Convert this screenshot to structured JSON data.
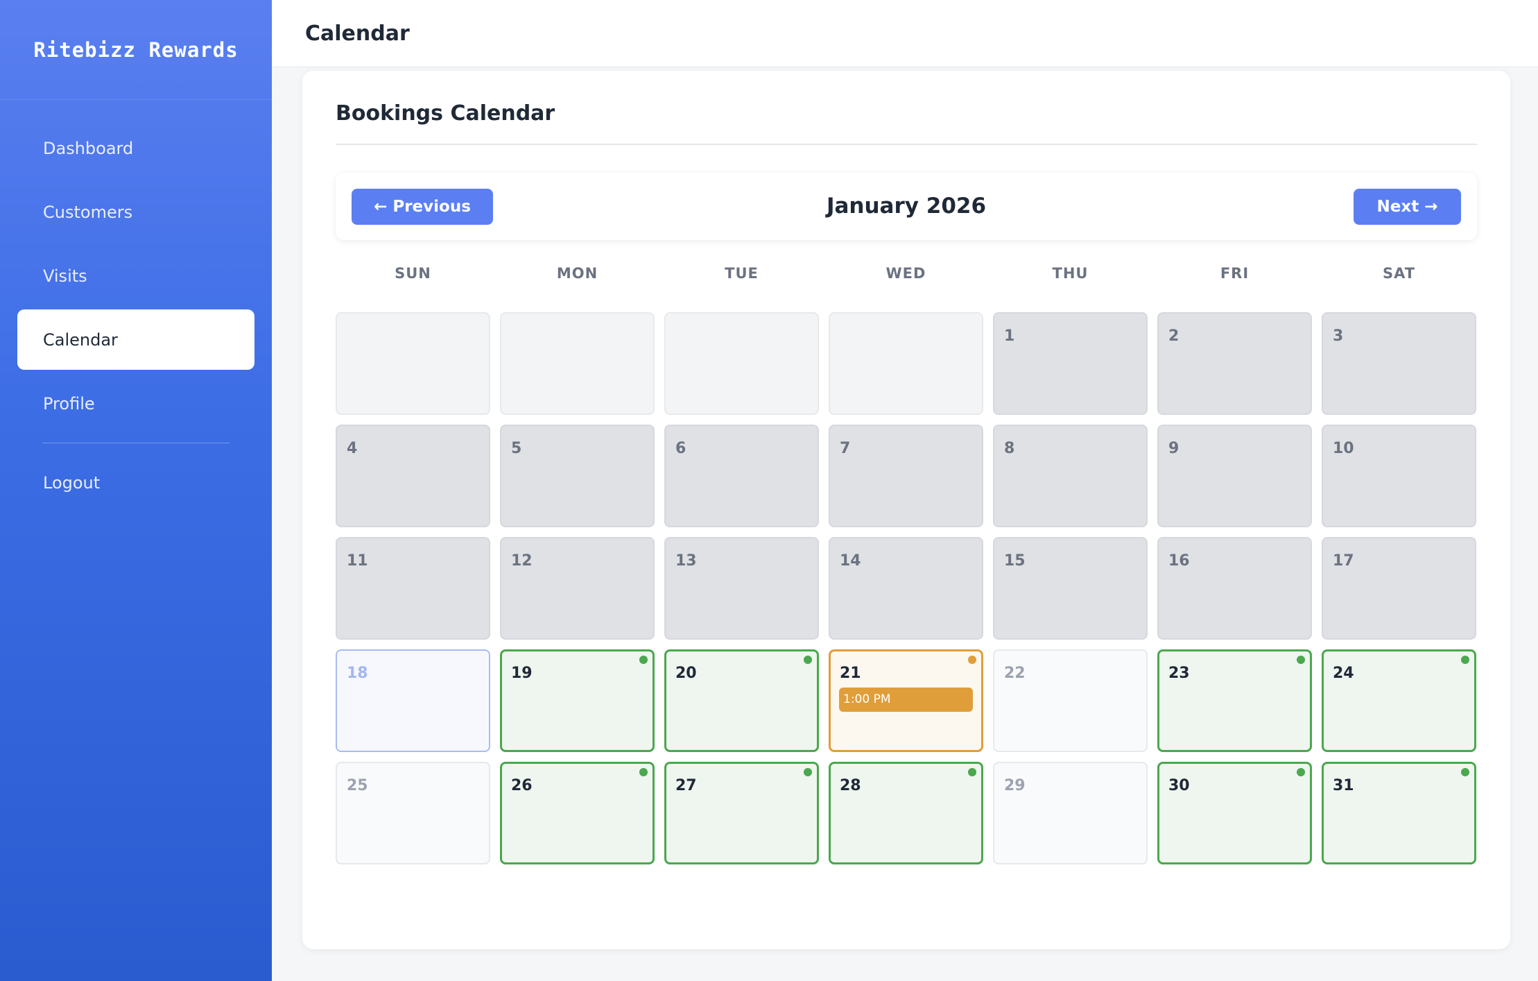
{
  "sidebar": {
    "brand": "Ritebizz Rewards",
    "items": [
      {
        "label": "Dashboard",
        "active": false
      },
      {
        "label": "Customers",
        "active": false
      },
      {
        "label": "Visits",
        "active": false
      },
      {
        "label": "Calendar",
        "active": true
      },
      {
        "label": "Profile",
        "active": false
      }
    ],
    "logout": "Logout"
  },
  "header": {
    "title": "Calendar"
  },
  "main": {
    "card_title": "Bookings Calendar",
    "month_label": "January 2026",
    "prev_label": "← Previous",
    "next_label": "Next →",
    "weekdays": [
      "SUN",
      "MON",
      "TUE",
      "WED",
      "THU",
      "FRI",
      "SAT"
    ],
    "status_colors": {
      "available": "#4aa84e",
      "booked": "#e09e3a",
      "today": "#a8bcf2"
    },
    "days": [
      {
        "day": "",
        "state": "empty"
      },
      {
        "day": "",
        "state": "empty"
      },
      {
        "day": "",
        "state": "empty"
      },
      {
        "day": "",
        "state": "empty"
      },
      {
        "day": "1",
        "state": "past"
      },
      {
        "day": "2",
        "state": "past"
      },
      {
        "day": "3",
        "state": "past"
      },
      {
        "day": "4",
        "state": "past"
      },
      {
        "day": "5",
        "state": "past"
      },
      {
        "day": "6",
        "state": "past"
      },
      {
        "day": "7",
        "state": "past"
      },
      {
        "day": "8",
        "state": "past"
      },
      {
        "day": "9",
        "state": "past"
      },
      {
        "day": "10",
        "state": "past"
      },
      {
        "day": "11",
        "state": "past"
      },
      {
        "day": "12",
        "state": "past"
      },
      {
        "day": "13",
        "state": "past"
      },
      {
        "day": "14",
        "state": "past"
      },
      {
        "day": "15",
        "state": "past"
      },
      {
        "day": "16",
        "state": "past"
      },
      {
        "day": "17",
        "state": "past"
      },
      {
        "day": "18",
        "state": "today"
      },
      {
        "day": "19",
        "state": "avail"
      },
      {
        "day": "20",
        "state": "avail"
      },
      {
        "day": "21",
        "state": "booked",
        "event": "1:00 PM"
      },
      {
        "day": "22",
        "state": "closed"
      },
      {
        "day": "23",
        "state": "avail"
      },
      {
        "day": "24",
        "state": "avail"
      },
      {
        "day": "25",
        "state": "closed"
      },
      {
        "day": "26",
        "state": "avail"
      },
      {
        "day": "27",
        "state": "avail"
      },
      {
        "day": "28",
        "state": "avail"
      },
      {
        "day": "29",
        "state": "closed"
      },
      {
        "day": "30",
        "state": "avail"
      },
      {
        "day": "31",
        "state": "avail"
      }
    ]
  }
}
